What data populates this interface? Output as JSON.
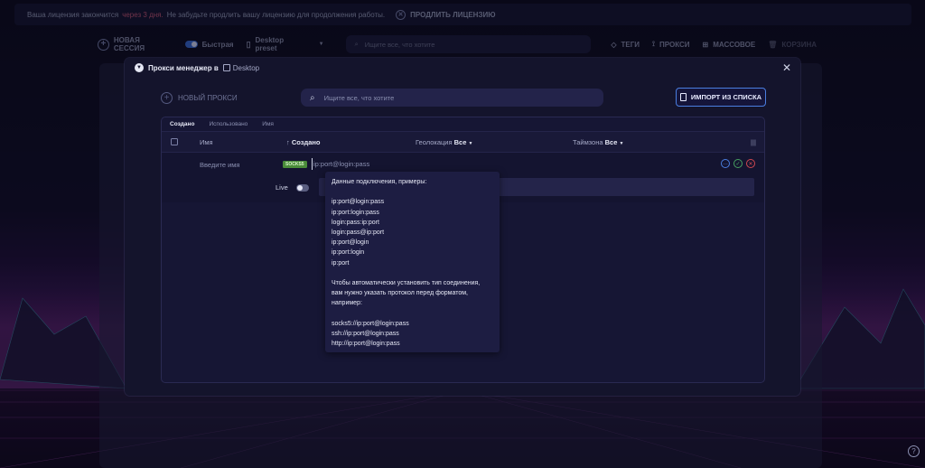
{
  "license": {
    "prefix": "Ваша лицензия закончится",
    "warning": "через 3 дня.",
    "suffix": "Не забудьте продлить вашу лицензию для продолжения работы.",
    "renew": "ПРОДЛИТЬ ЛИЦЕНЗИЮ"
  },
  "toolbar": {
    "new_session": "НОВАЯ СЕССИЯ",
    "quick": "Быстрая",
    "preset": "Desktop preset",
    "search_placeholder": "Ищите все, что хотите",
    "tags": "ТЕГИ",
    "proxies": "ПРОКСИ",
    "bulk": "МАССОВОЕ",
    "trash": "КОРЗИНА"
  },
  "modal": {
    "title": "Прокси менеджер в",
    "workspace": "Desktop",
    "new_proxy": "НОВЫЙ ПРОКСИ",
    "search_placeholder": "Ищите все, что хотите",
    "import_button": "ИМПОРТ ИЗ СПИСКА",
    "tabs": [
      "Создано",
      "Использовано",
      "Имя"
    ],
    "columns": {
      "name": "Имя",
      "created": "Создано",
      "geo": "Геолокация",
      "geo_filter": "Все",
      "timezone": "Таймзона",
      "tz_filter": "Все"
    },
    "edit_row": {
      "name_placeholder": "Введите имя",
      "protocol": "SOCKS5",
      "proxy_placeholder": "ip:port@login:pass",
      "live_label": "Live"
    }
  },
  "tooltip": {
    "lines": [
      "Данные подключения, примеры:",
      "",
      "ip:port@login:pass",
      "ip:port:login:pass",
      "login:pass:ip:port",
      "login:pass@ip:port",
      "ip:port@login",
      "ip:port:login",
      "ip:port",
      "",
      "Чтобы автоматически установить тип соединения,",
      "вам нужно указать протокол перед форматом,",
      "например:",
      "",
      "socks5://ip:port@login:pass",
      "ssh://ip:port@login:pass",
      "http://ip:port@login:pass"
    ]
  },
  "colors": {
    "accent": "#4a7ee0",
    "warning": "#c85a7a",
    "socks_badge": "#4a8c3a",
    "modal_bg": "#14142c"
  }
}
